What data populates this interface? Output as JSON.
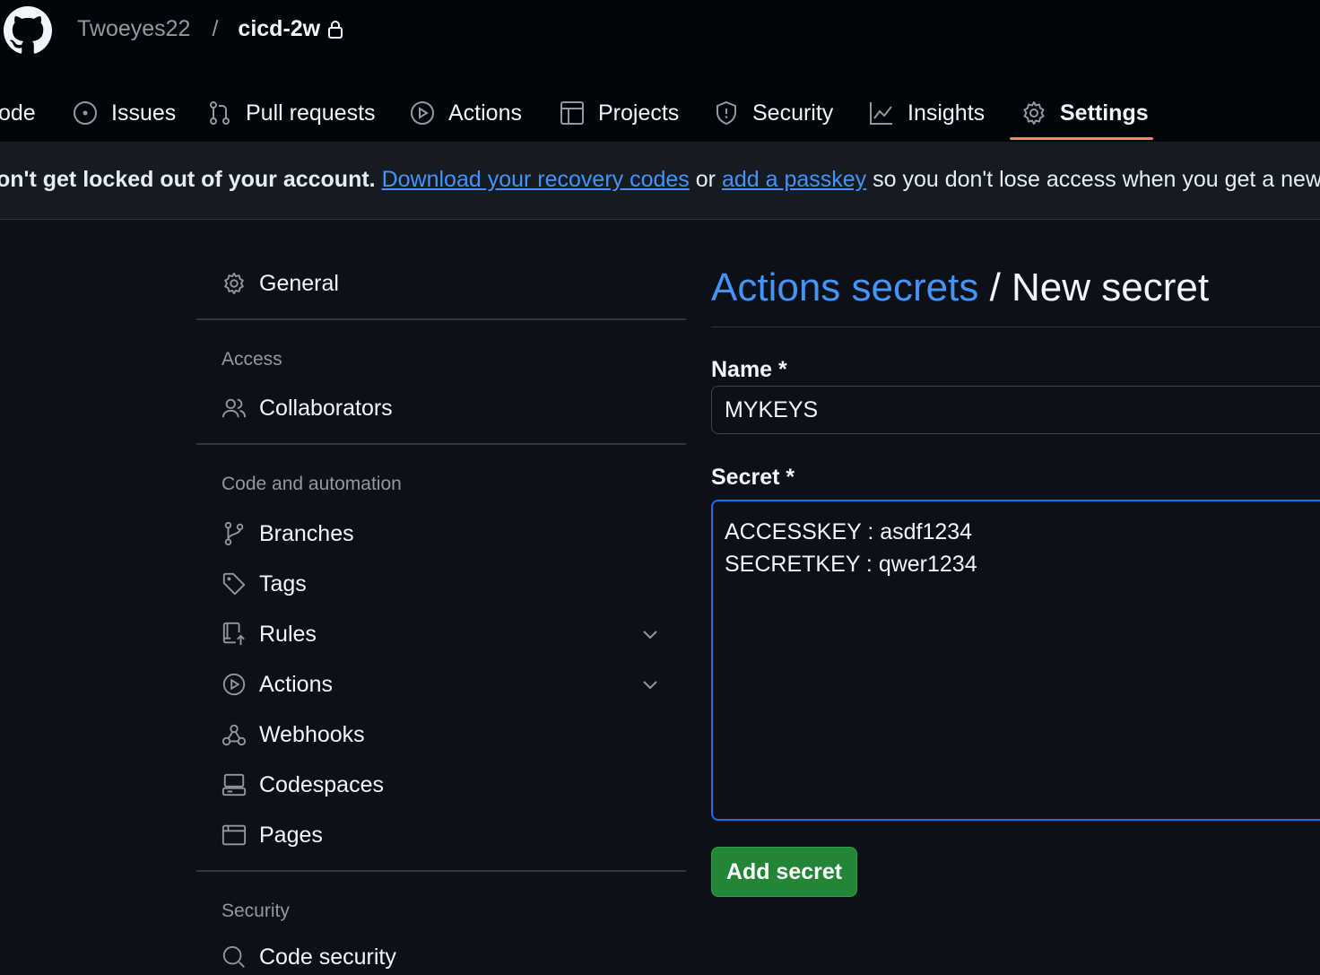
{
  "header": {
    "owner": "Twoeyes22",
    "separator": "/",
    "repo": "cicd-2w"
  },
  "nav": {
    "tabs": [
      {
        "label": "ode",
        "icon": "code-icon"
      },
      {
        "label": "Issues",
        "icon": "issue-icon"
      },
      {
        "label": "Pull requests",
        "icon": "pull-request-icon"
      },
      {
        "label": "Actions",
        "icon": "play-icon"
      },
      {
        "label": "Projects",
        "icon": "table-icon"
      },
      {
        "label": "Security",
        "icon": "shield-icon"
      },
      {
        "label": "Insights",
        "icon": "graph-icon"
      },
      {
        "label": "Settings",
        "icon": "gear-icon",
        "active": true
      }
    ]
  },
  "banner": {
    "bold_text": "on't get locked out of your account.",
    "link1": "Download your recovery codes",
    "middle": " or ",
    "link2": "add a passkey",
    "tail": " so you don't lose access when you get a new devic"
  },
  "sidebar": {
    "general": "General",
    "groups": {
      "access": "Access",
      "code_automation": "Code and automation",
      "security": "Security"
    },
    "items": {
      "collaborators": "Collaborators",
      "branches": "Branches",
      "tags": "Tags",
      "rules": "Rules",
      "actions": "Actions",
      "webhooks": "Webhooks",
      "codespaces": "Codespaces",
      "pages": "Pages",
      "code_security": "Code security"
    }
  },
  "main": {
    "title_link": "Actions secrets",
    "title_rest": " / New secret",
    "name_label": "Name *",
    "name_value": "MYKEYS",
    "secret_label": "Secret *",
    "secret_value": "ACCESSKEY : asdf1234\nSECRETKEY : qwer1234",
    "submit": "Add secret"
  },
  "colors": {
    "accent_link": "#4493f8",
    "tab_underline": "#f78166",
    "button_green": "#238636",
    "focus_border": "#1f6feb"
  }
}
